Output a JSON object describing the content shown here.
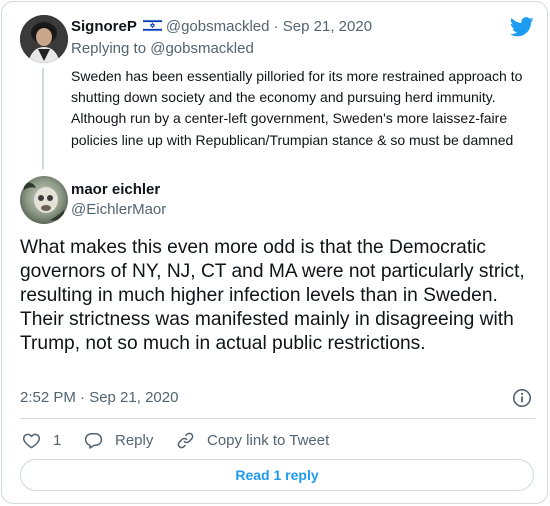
{
  "parent_tweet": {
    "author_name": "SignoreP",
    "handle_time": "@gobsmackled · Sep 21, 2020",
    "replying_to_prefix": "Replying to ",
    "replying_to_handle": "@gobsmackled",
    "text": "Sweden has been essentially pilloried for its more restrained approach to shutting down society and the economy and pursuing herd immunity. Although run by a center-left government, Sweden's more laissez-faire policies line up with Republican/Trumpian stance & so must be damned"
  },
  "main_tweet": {
    "author_name": "maor eichler",
    "handle": "@EichlerMaor",
    "text": "What makes this even more odd is that the Democratic governors of NY, NJ, CT and MA were not particularly strict, resulting in much higher infection levels than in Sweden. Their strictness was manifested mainly in disagreeing with Trump, not so much in actual public restrictions.",
    "timestamp": "2:52 PM · Sep 21, 2020"
  },
  "actions": {
    "like_count": "1",
    "reply_label": "Reply",
    "copy_link_label": "Copy link to Tweet"
  },
  "read_replies_label": "Read 1 reply",
  "colors": {
    "accent": "#1d9bf0",
    "muted": "#536471",
    "border": "#cfd9de",
    "flag_blue": "#0038b8"
  },
  "icons": [
    "twitter-bird-icon",
    "info-icon",
    "heart-icon",
    "reply-icon",
    "link-icon",
    "israel-flag-icon"
  ]
}
